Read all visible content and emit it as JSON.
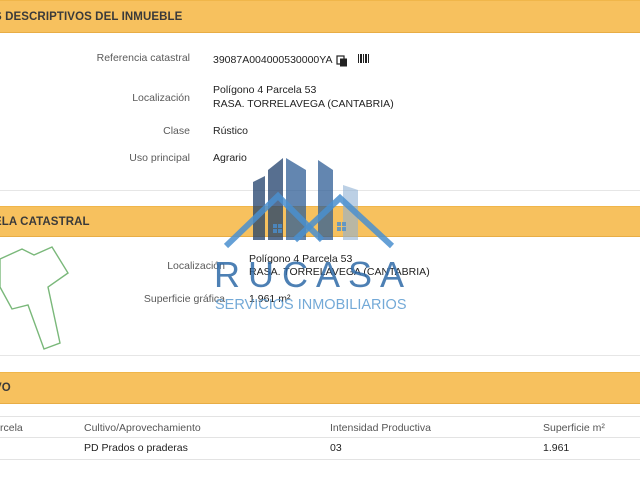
{
  "section1": {
    "header": "S DESCRIPTIVOS DEL INMUEBLE",
    "fields": {
      "ref_label": "Referencia catastral",
      "ref_value": "39087A004000530000YA",
      "loc_label": "Localización",
      "loc_line1": "Polígono 4 Parcela 53",
      "loc_line2": "RASA. TORRELAVEGA (CANTABRIA)",
      "clase_label": "Clase",
      "clase_value": "Rústico",
      "uso_label": "Uso principal",
      "uso_value": "Agrario"
    }
  },
  "section2": {
    "header": "ELA CATASTRAL",
    "loc_label": "Localización",
    "loc_line1": "Polígono 4 Parcela 53",
    "loc_line2": "RASA. TORRELAVEGA (CANTABRIA)",
    "sup_label": "Superficie gráfica",
    "sup_value": "1.961 m²"
  },
  "section3": {
    "header": "VO",
    "columns": [
      "rcela",
      "Cultivo/Aprovechamiento",
      "Intensidad Productiva",
      "Superficie m²"
    ],
    "rows": [
      [
        "",
        "PD Prados o praderas",
        "03",
        "1.961"
      ]
    ]
  },
  "watermark": {
    "brand": "RUCASA",
    "tagline": "SERVICIOS INMOBILIARIOS"
  },
  "colors": {
    "band": "#f7c15e",
    "logo_dark": "#1f3f6b",
    "logo_light": "#5b9bd1"
  }
}
